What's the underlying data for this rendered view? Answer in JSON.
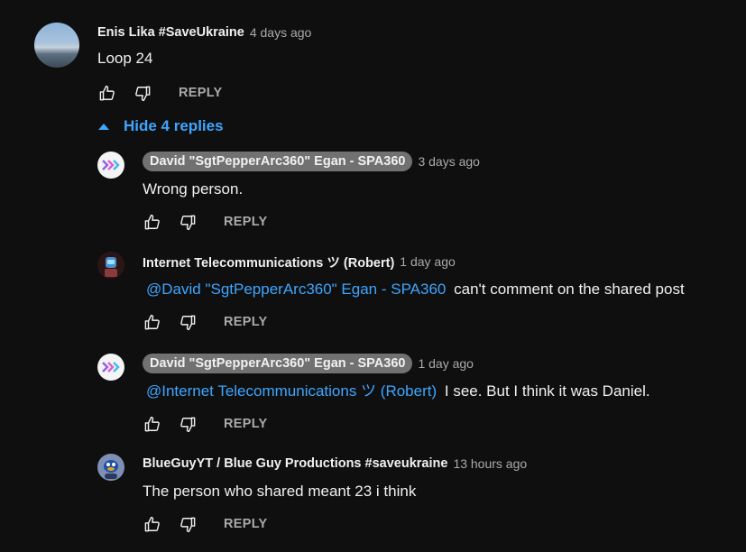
{
  "comments": {
    "top": {
      "author": "Enis Lika #SaveUkraine",
      "time": "4 days ago",
      "text": "Loop 24",
      "reply_label": "REPLY"
    },
    "toggle_label": "Hide 4 replies",
    "replies": [
      {
        "author": "David \"SgtPepperArc360\" Egan - SPA360",
        "author_is_creator_chip": true,
        "time": "3 days ago",
        "mention": "",
        "text": "Wrong person.",
        "reply_label": "REPLY"
      },
      {
        "author": "Internet Telecommunications ツ (Robert)",
        "author_is_creator_chip": false,
        "time": "1 day ago",
        "mention": "@David \"SgtPepperArc360\" Egan - SPA360",
        "text": "can't comment on the shared post",
        "reply_label": "REPLY"
      },
      {
        "author": "David \"SgtPepperArc360\" Egan - SPA360",
        "author_is_creator_chip": true,
        "time": "1 day ago",
        "mention": "@Internet Telecommunications ツ (Robert)",
        "text": "I see. But I think it was Daniel.",
        "reply_label": "REPLY"
      },
      {
        "author": "BlueGuyYT / Blue Guy Productions #saveukraine",
        "author_is_creator_chip": false,
        "time": "13 hours ago",
        "mention": "",
        "text": "The person who shared meant 23 i think",
        "reply_label": "REPLY"
      }
    ]
  },
  "icons": {
    "like": "thumbs-up-icon",
    "dislike": "thumbs-down-icon",
    "toggle": "caret-up-icon"
  },
  "colors": {
    "background": "#0f0f0f",
    "link": "#3ea6ff",
    "muted": "#aaaaaa",
    "chip": "#717171"
  }
}
